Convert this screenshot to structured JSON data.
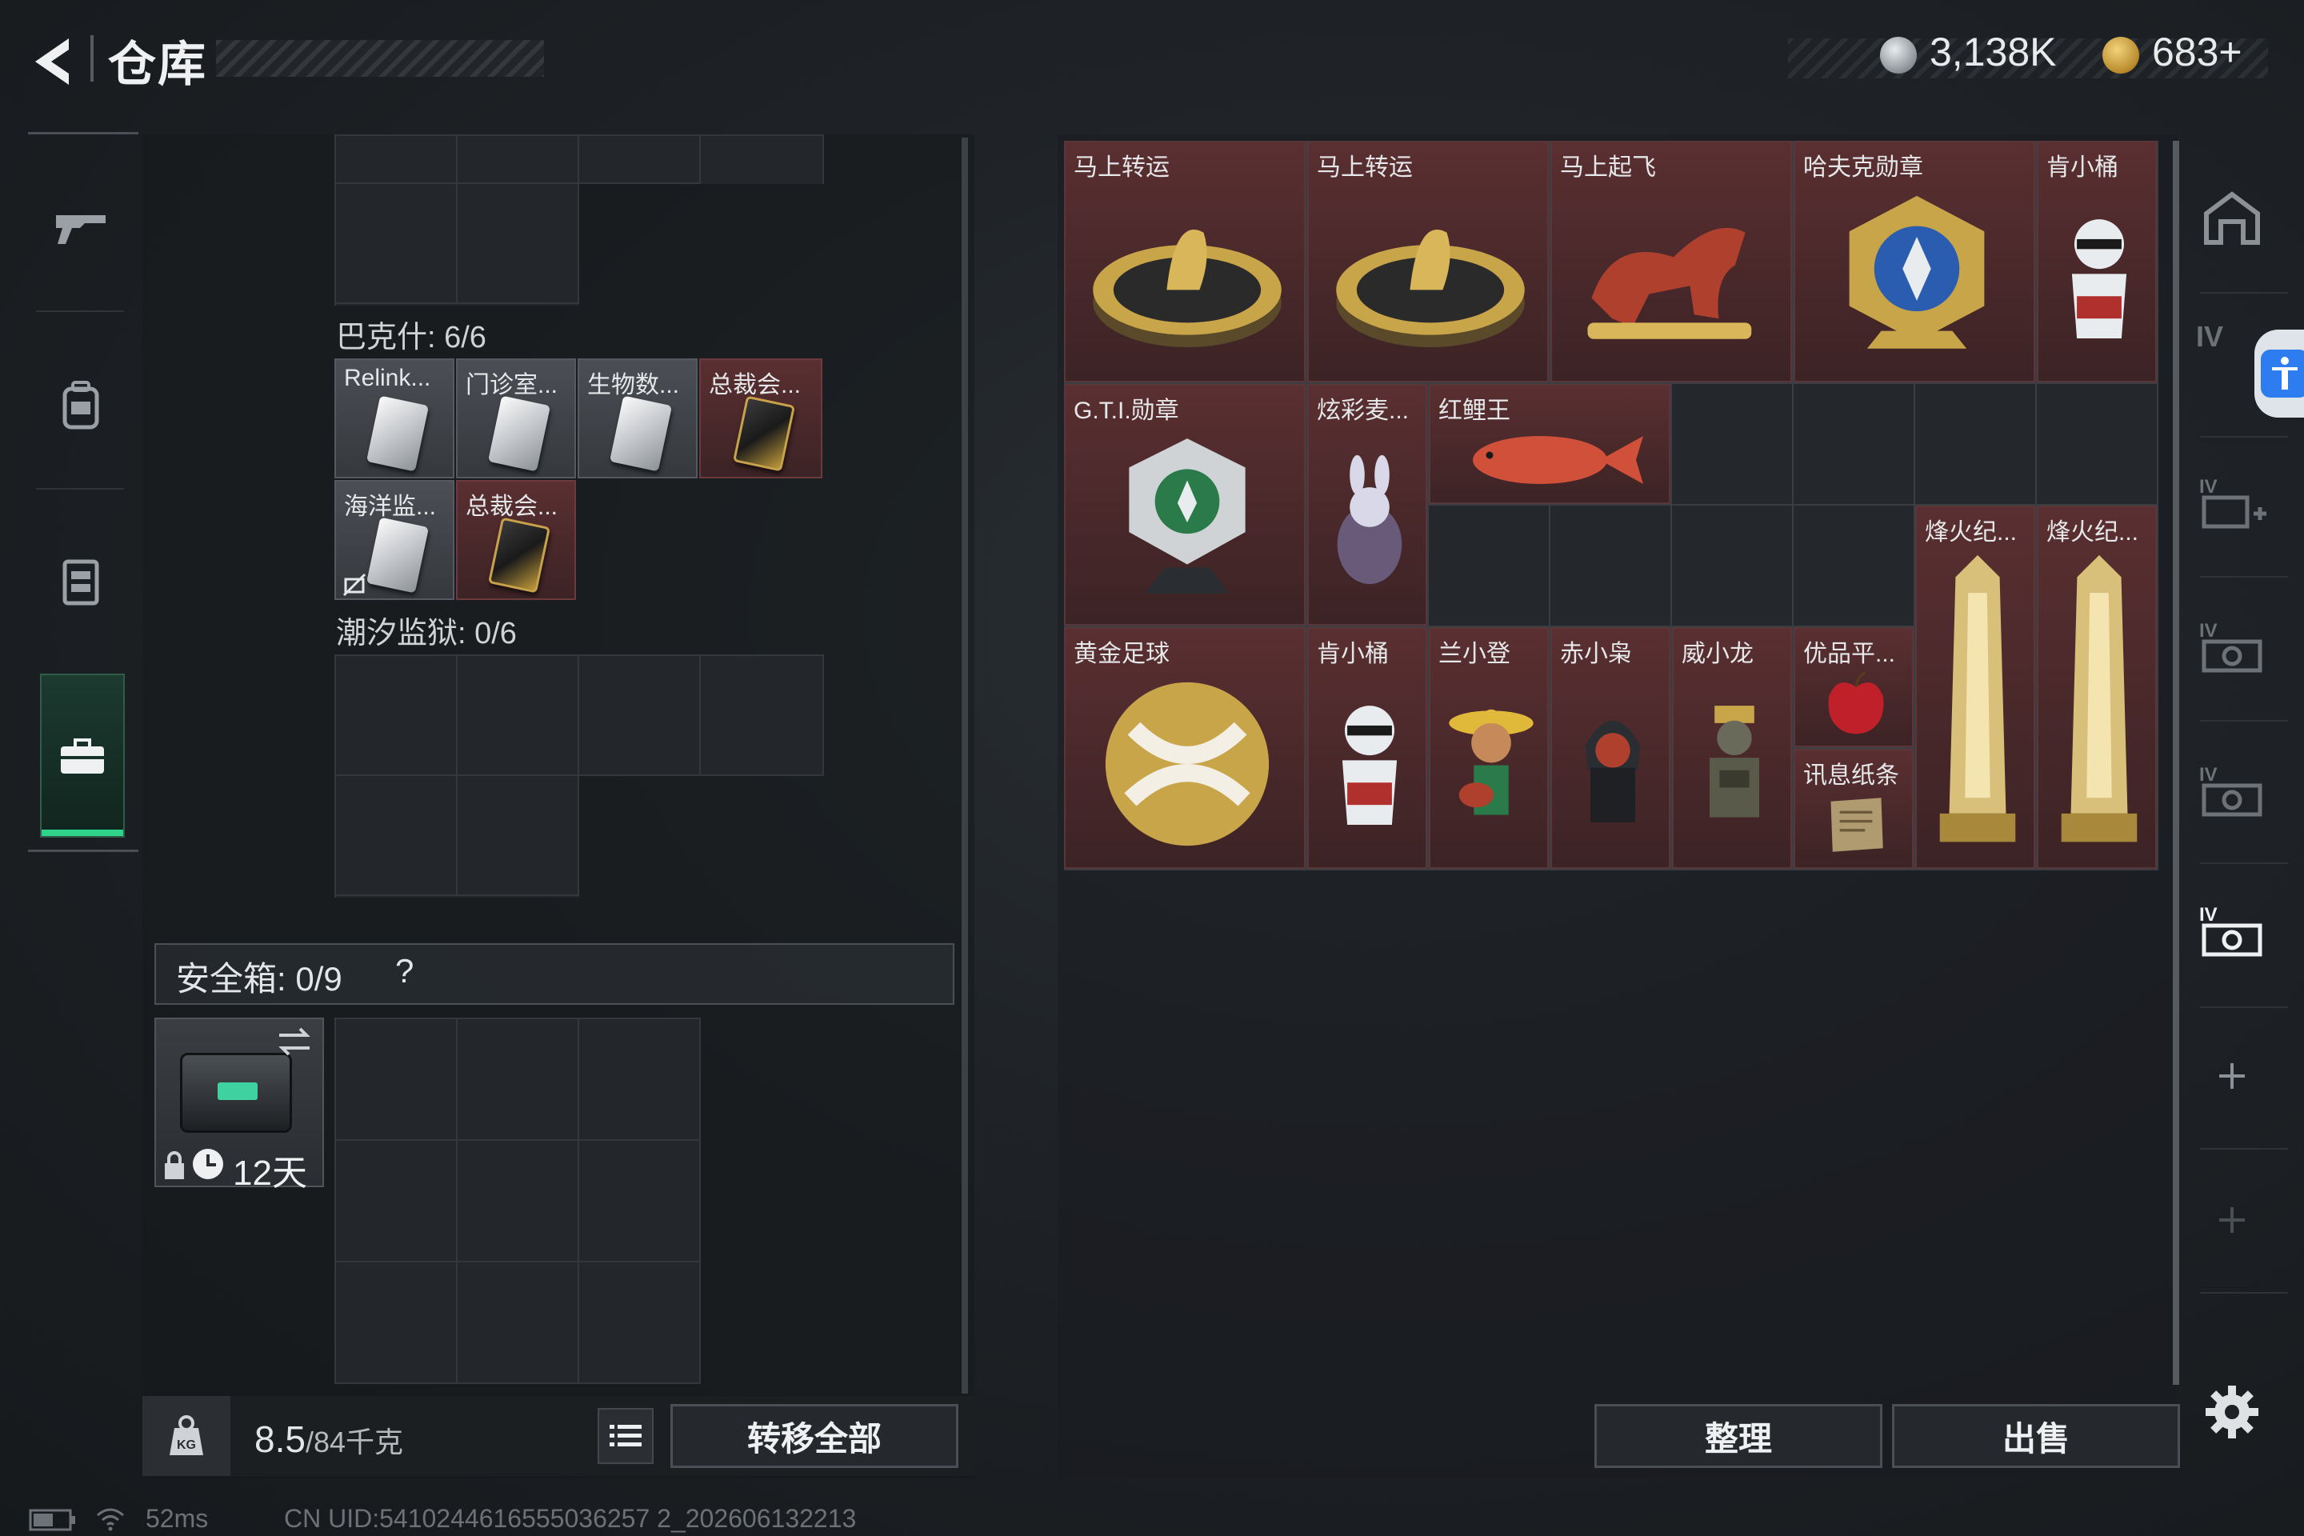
{
  "header": {
    "title": "仓库",
    "silver": "3,138K",
    "gold": "683+"
  },
  "left": {
    "bakeshi_label": "巴克什: 6/6",
    "bakeshi_items": [
      {
        "label": "Relink...",
        "tone": "gray"
      },
      {
        "label": "门诊室...",
        "tone": "gray"
      },
      {
        "label": "生物数...",
        "tone": "gray"
      },
      {
        "label": "总裁会...",
        "tone": "red"
      },
      {
        "label": "海洋监...",
        "tone": "gray"
      },
      {
        "label": "总裁会...",
        "tone": "red"
      }
    ],
    "prison_label": "潮汐监狱: 0/6",
    "safe_label": "安全箱: 0/9",
    "safe_help": "?",
    "safe_days": "12天",
    "weight_value": "8.5",
    "weight_max": "/84千克",
    "transfer_all": "转移全部"
  },
  "storage": {
    "items": [
      {
        "label": "马上转运",
        "tone": "red",
        "icon": "horse-coin"
      },
      {
        "label": "马上转运",
        "tone": "red",
        "icon": "horse-coin"
      },
      {
        "label": "马上起飞",
        "tone": "red",
        "icon": "red-horse"
      },
      {
        "label": "哈夫克勋章",
        "tone": "red",
        "icon": "gold-medal"
      },
      {
        "label": "肯小桶",
        "tone": "red",
        "icon": "kfc-figure"
      },
      {
        "label": "G.T.I.勋章",
        "tone": "red",
        "icon": "silver-medal"
      },
      {
        "label": "炫彩麦...",
        "tone": "red",
        "icon": "rabbit-egg"
      },
      {
        "label": "红鲤王",
        "tone": "red",
        "icon": "red-carp"
      },
      {
        "label": "烽火纪...",
        "tone": "red",
        "icon": "gold-trophy"
      },
      {
        "label": "烽火纪...",
        "tone": "red",
        "icon": "gold-trophy"
      },
      {
        "label": "黄金足球",
        "tone": "red",
        "icon": "gold-ball"
      },
      {
        "label": "肯小桶",
        "tone": "red",
        "icon": "kfc-figure"
      },
      {
        "label": "兰小登",
        "tone": "red",
        "icon": "sombrero-figure"
      },
      {
        "label": "赤小枭",
        "tone": "red",
        "icon": "hood-figure"
      },
      {
        "label": "威小龙",
        "tone": "red",
        "icon": "soldier-figure"
      },
      {
        "label": "优品平...",
        "tone": "red",
        "icon": "apple"
      },
      {
        "label": "讯息纸条",
        "tone": "red",
        "icon": "paper-note"
      }
    ],
    "sort_button": "整理",
    "sell_button": "出售"
  },
  "status": {
    "ping": "52ms",
    "uid": "CN UID:5410244616555036257 2_202606132213"
  }
}
